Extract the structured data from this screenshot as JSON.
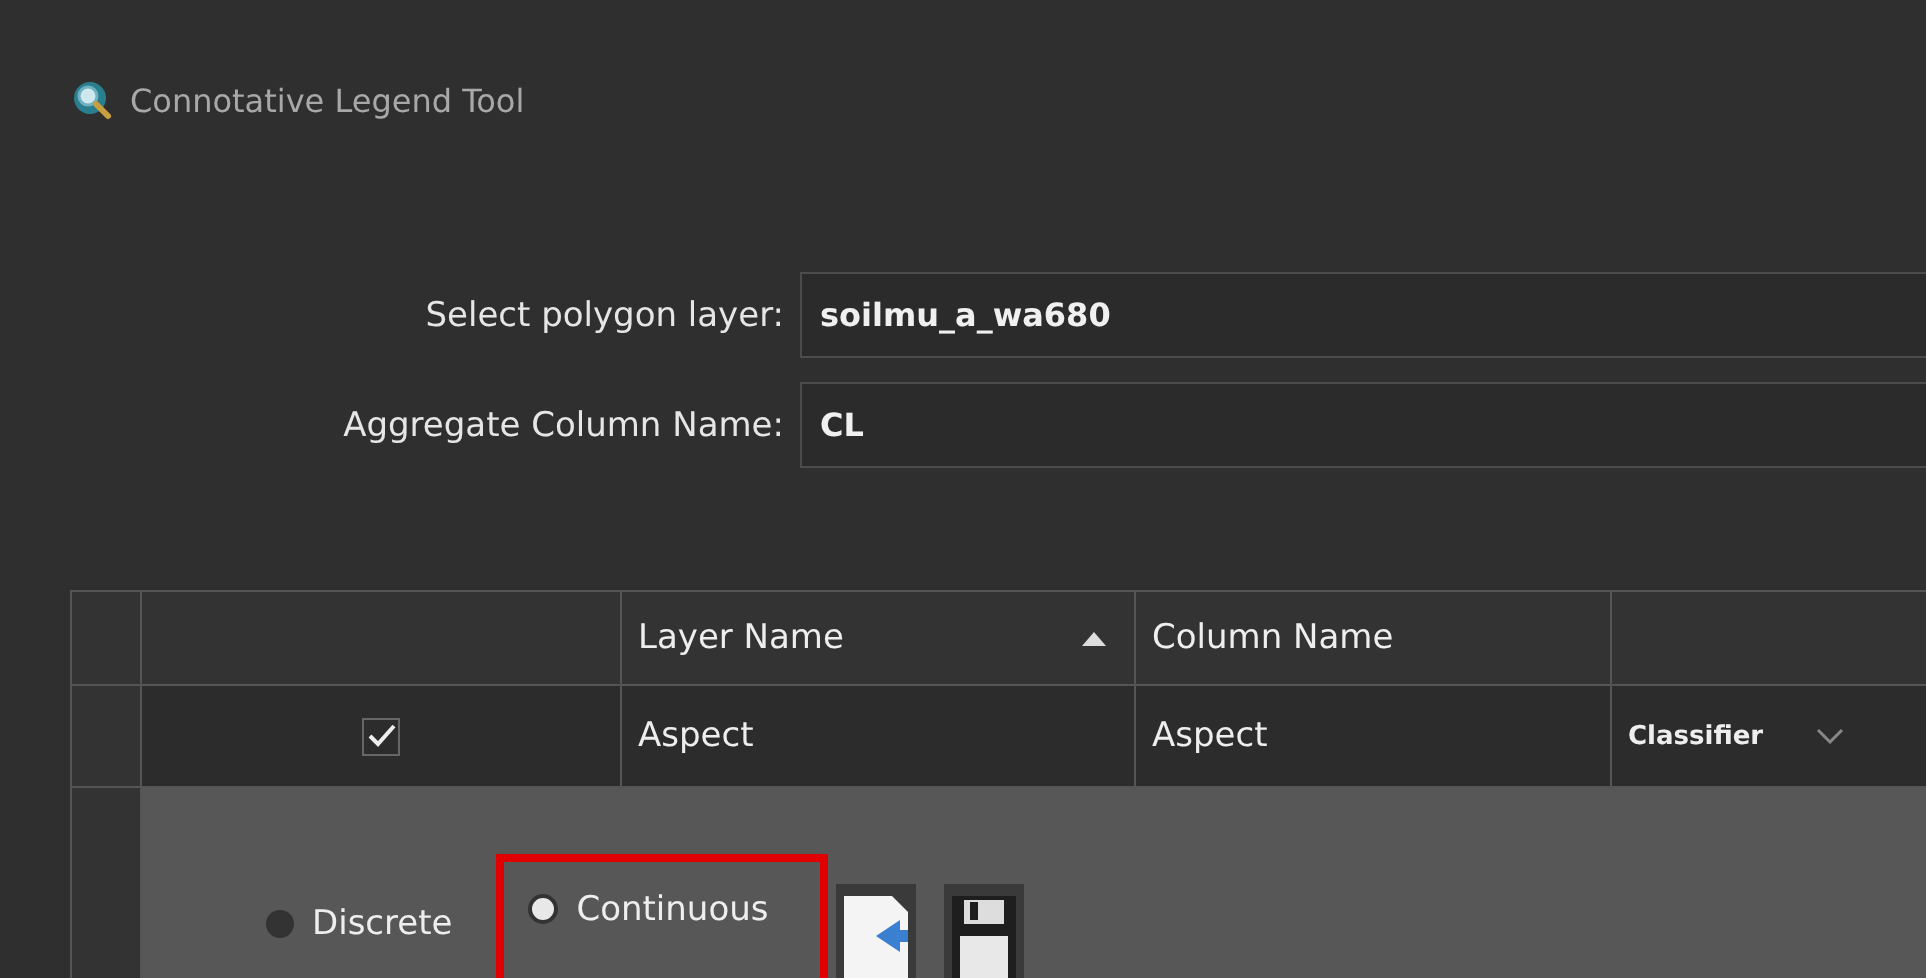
{
  "window": {
    "title": "Connotative Legend Tool"
  },
  "form": [
    {
      "label": "Select polygon layer:",
      "value": "soilmu_a_wa680"
    },
    {
      "label": "Aggregate Column Name:",
      "value": "CL"
    }
  ],
  "table": {
    "columns": [
      {
        "label": "Layer Name",
        "sorted": true
      },
      {
        "label": "Column Name",
        "sorted": false
      }
    ],
    "rows": [
      {
        "checked": true,
        "layer_name": "Aspect",
        "column_name": "Aspect",
        "method": "Classifier"
      }
    ],
    "detail": {
      "options": [
        {
          "label": "Discrete",
          "selected": false,
          "highlighted": false
        },
        {
          "label": "Continuous",
          "selected": true,
          "highlighted": true
        }
      ]
    }
  }
}
